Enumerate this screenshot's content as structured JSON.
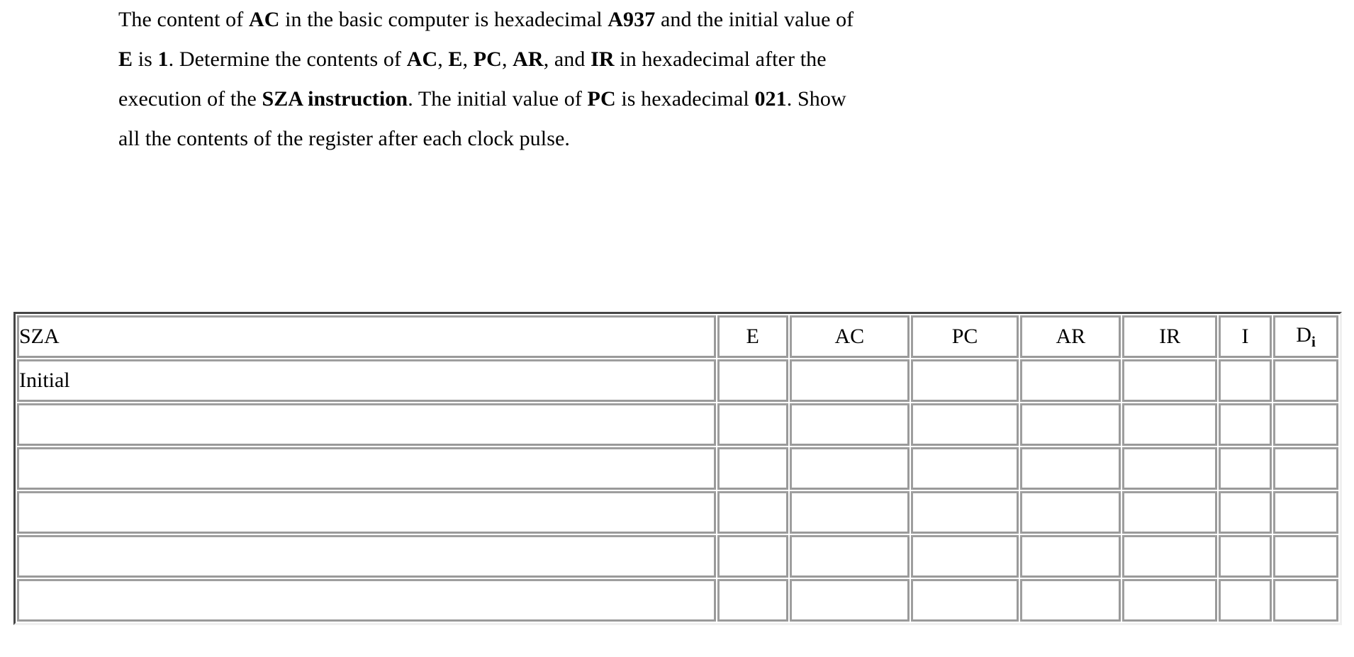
{
  "question": {
    "lines": [
      [
        {
          "t": "The content of ",
          "b": false
        },
        {
          "t": "AC",
          "b": true
        },
        {
          "t": " in the basic computer is hexadecimal ",
          "b": false
        },
        {
          "t": "A937",
          "b": true
        },
        {
          "t": " and the initial value of",
          "b": false
        }
      ],
      [
        {
          "t": "E",
          "b": true
        },
        {
          "t": " is ",
          "b": false
        },
        {
          "t": "1",
          "b": true
        },
        {
          "t": ". Determine the contents of ",
          "b": false
        },
        {
          "t": "AC",
          "b": true
        },
        {
          "t": ", ",
          "b": false
        },
        {
          "t": "E",
          "b": true
        },
        {
          "t": ", ",
          "b": false
        },
        {
          "t": "PC",
          "b": true
        },
        {
          "t": ", ",
          "b": false
        },
        {
          "t": "AR",
          "b": true
        },
        {
          "t": ", and ",
          "b": false
        },
        {
          "t": "IR",
          "b": true
        },
        {
          "t": " in hexadecimal after the",
          "b": false
        }
      ],
      [
        {
          "t": "execution of the ",
          "b": false
        },
        {
          "t": "SZA instruction",
          "b": true
        },
        {
          "t": ". The initial value of ",
          "b": false
        },
        {
          "t": "PC",
          "b": true
        },
        {
          "t": " is hexadecimal ",
          "b": false
        },
        {
          "t": "021",
          "b": true
        },
        {
          "t": ". Show",
          "b": false
        }
      ],
      [
        {
          "t": "all the contents of the register after each clock pulse.",
          "b": false
        }
      ]
    ],
    "plain_text": "The content of AC in the basic computer is hexadecimal A937 and the initial value of E is 1. Determine the contents of AC, E, PC, AR, and IR in hexadecimal after the execution of the SZA instruction. The initial value of PC is hexadecimal 021. Show all the contents of the register after each clock pulse."
  },
  "table": {
    "headers": [
      {
        "label": "SZA",
        "sub": "",
        "align": "left"
      },
      {
        "label": "E",
        "sub": "",
        "align": "center"
      },
      {
        "label": "AC",
        "sub": "",
        "align": "center"
      },
      {
        "label": "PC",
        "sub": "",
        "align": "center"
      },
      {
        "label": "AR",
        "sub": "",
        "align": "center"
      },
      {
        "label": "IR",
        "sub": "",
        "align": "center"
      },
      {
        "label": "I",
        "sub": "",
        "align": "center"
      },
      {
        "label": "D",
        "sub": "i",
        "align": "center"
      }
    ],
    "rows": [
      {
        "label": "Initial",
        "cells": [
          "",
          "",
          "",
          "",
          "",
          "",
          ""
        ]
      },
      {
        "label": "",
        "cells": [
          "",
          "",
          "",
          "",
          "",
          "",
          ""
        ]
      },
      {
        "label": "",
        "cells": [
          "",
          "",
          "",
          "",
          "",
          "",
          ""
        ]
      },
      {
        "label": "",
        "cells": [
          "",
          "",
          "",
          "",
          "",
          "",
          ""
        ]
      },
      {
        "label": "",
        "cells": [
          "",
          "",
          "",
          "",
          "",
          "",
          ""
        ]
      },
      {
        "label": "",
        "cells": [
          "",
          "",
          "",
          "",
          "",
          "",
          ""
        ]
      }
    ]
  },
  "colors": {
    "text": "#000000",
    "page_background": "#ffffff",
    "border_dark": "#9a9a9a",
    "border_light": "#f2f2f2"
  }
}
